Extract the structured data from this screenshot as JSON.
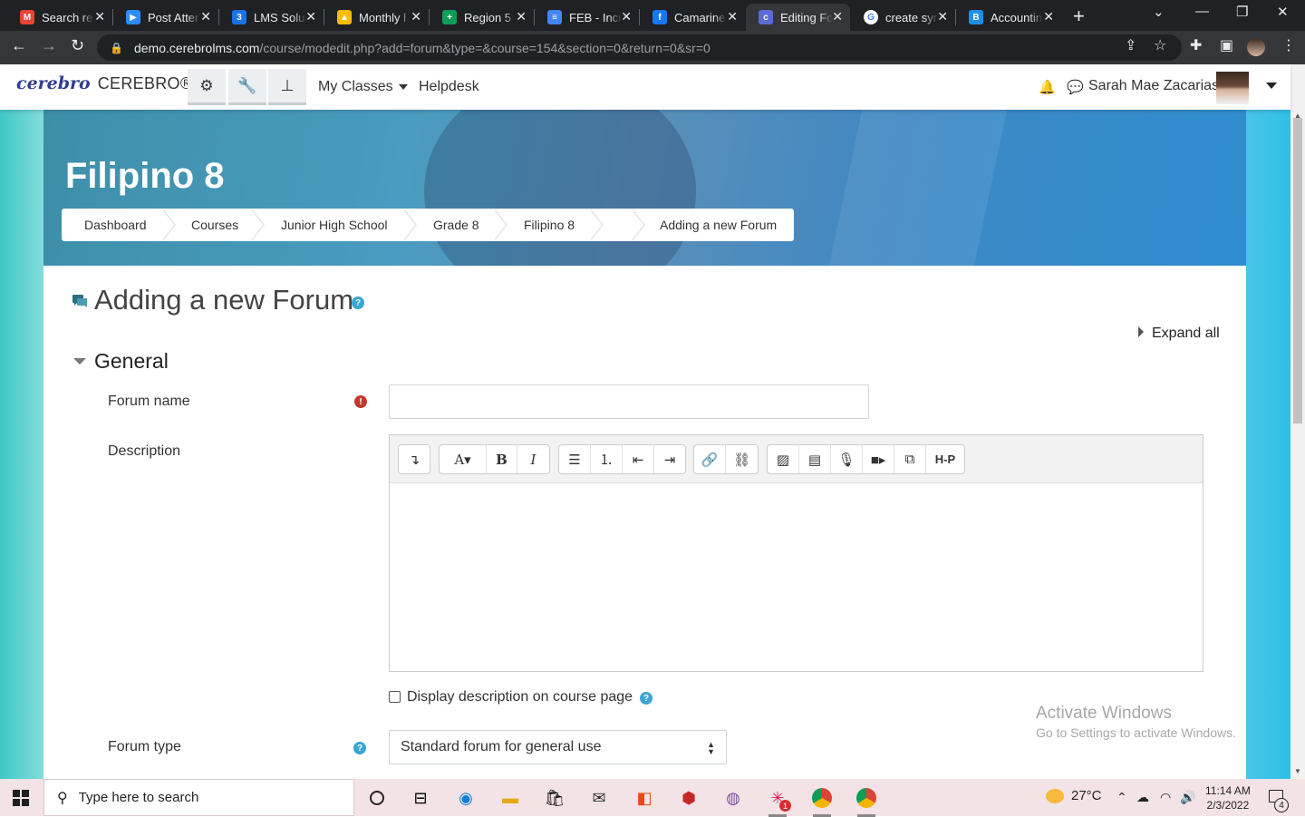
{
  "browser": {
    "tabs": [
      {
        "title": "Search re",
        "favicon": "gmail-icon",
        "color": "#ea4335",
        "glyph": "M"
      },
      {
        "title": "Post Atter",
        "favicon": "zoom-icon",
        "color": "#2d8cff",
        "glyph": "▶"
      },
      {
        "title": "LMS Solut",
        "favicon": "calendar-icon",
        "color": "#1a73e8",
        "glyph": "3"
      },
      {
        "title": "Monthly l",
        "favicon": "drive-icon",
        "color": "#fbbc04",
        "glyph": "▲"
      },
      {
        "title": "Region 5",
        "favicon": "sheets-icon",
        "color": "#0f9d58",
        "glyph": "+"
      },
      {
        "title": "FEB - Incr",
        "favicon": "docs-icon",
        "color": "#4285f4",
        "glyph": "≡"
      },
      {
        "title": "Camarine",
        "favicon": "facebook-icon",
        "color": "#1877f2",
        "glyph": "f"
      },
      {
        "title": "Editing Fo",
        "favicon": "cerebro-icon",
        "color": "#5b6bd6",
        "glyph": "c"
      },
      {
        "title": "create syn",
        "favicon": "google-icon",
        "color": "#ffffff",
        "glyph": "G"
      },
      {
        "title": "Accountin",
        "favicon": "bootstrap-icon",
        "color": "#1f8ee8",
        "glyph": "B"
      }
    ],
    "active_tab": 7,
    "url_host": "demo.cerebrolms.com",
    "url_path": "/course/modedit.php?add=forum&type=&course=154&section=0&return=0&sr=0"
  },
  "navbar": {
    "site_name": "CEREBRO®",
    "logo_text": "cerebro",
    "my_classes": "My Classes",
    "helpdesk": "Helpdesk",
    "user_name": "Sarah Mae Zacarias"
  },
  "header": {
    "course_title": "Filipino 8",
    "breadcrumb": [
      "Dashboard",
      "Courses",
      "Junior High School",
      "Grade 8",
      "Filipino 8",
      "",
      "Adding a new Forum"
    ]
  },
  "main": {
    "heading": "Adding a new Forum",
    "expand_all": "Expand all",
    "general_title": "General",
    "forum_name_label": "Forum name",
    "forum_name_value": "",
    "description_label": "Description",
    "description_value": "",
    "show_description_label": "Display description on course page",
    "show_description_checked": false,
    "forum_type_label": "Forum type",
    "forum_type_value": "Standard forum for general use"
  },
  "watermark": {
    "line1": "Activate Windows",
    "line2": "Go to Settings to activate Windows."
  },
  "taskbar": {
    "search_placeholder": "Type here to search",
    "temperature": "27°C",
    "time": "11:14 AM",
    "date": "2/3/2022",
    "notification_count": "4",
    "slack_badge": "1"
  }
}
